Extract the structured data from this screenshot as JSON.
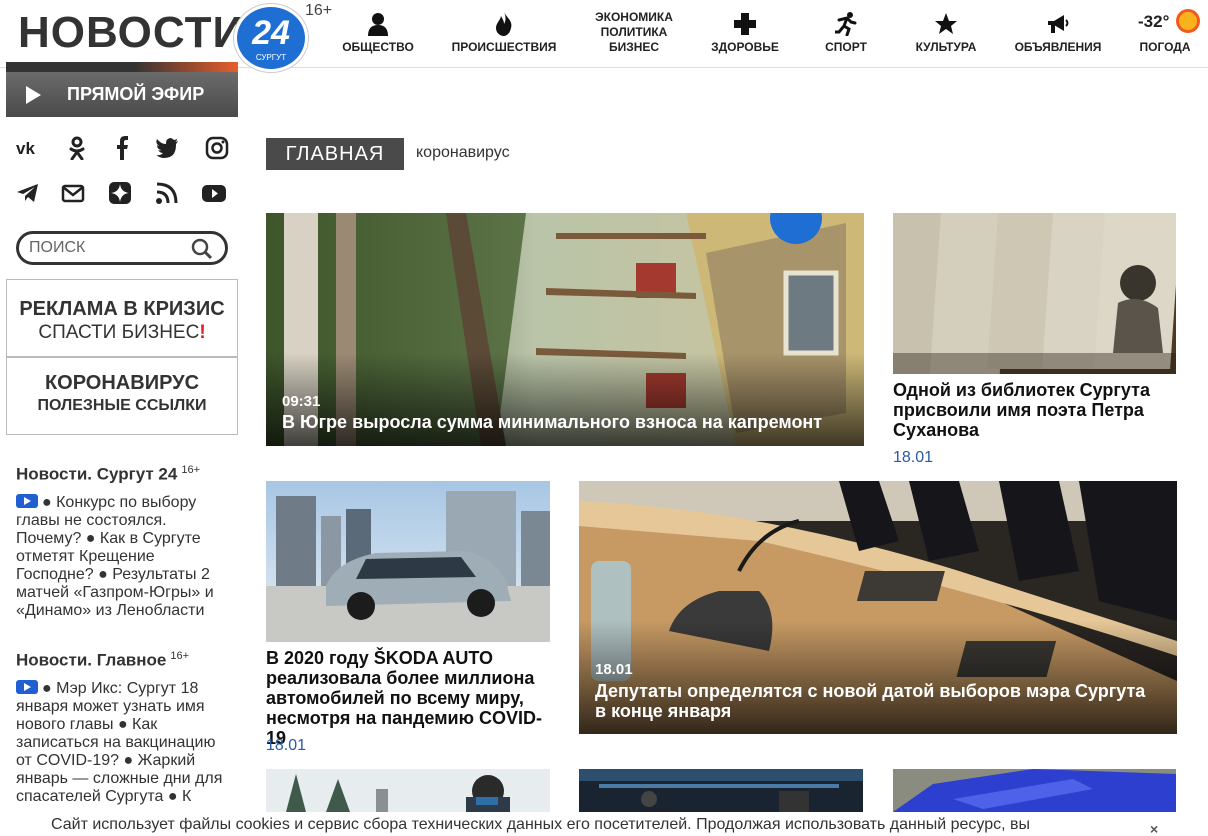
{
  "header": {
    "logo_text": "НОВОСТИ",
    "logo_number": "24",
    "logo_city": "СУРГУТ",
    "age_rating": "16+",
    "nav": [
      {
        "label": "ОБЩЕСТВО",
        "icon": "person-icon"
      },
      {
        "label": "ПРОИСШЕСТВИЯ",
        "icon": "fire-icon"
      },
      {
        "label": "ЗДОРОВЬЕ",
        "icon": "cross-icon"
      },
      {
        "label": "СПОРТ",
        "icon": "runner-icon"
      },
      {
        "label": "КУЛЬТУРА",
        "icon": "star-icon"
      },
      {
        "label": "ОБЪЯВЛЕНИЯ",
        "icon": "megaphone-icon"
      }
    ],
    "nav_multi": [
      "ЭКОНОМИКА",
      "ПОЛИТИКА",
      "БИЗНЕС"
    ],
    "weather": {
      "temp": "-32°",
      "label": "ПОГОДА"
    }
  },
  "live": {
    "label": "ПРЯМОЙ ЭФИР"
  },
  "social": [
    "vk-icon",
    "odnoklassniki-icon",
    "facebook-icon",
    "twitter-icon",
    "instagram-icon",
    "telegram-icon",
    "mail-icon",
    "yandex-zen-icon",
    "rss-icon",
    "youtube-icon"
  ],
  "search": {
    "placeholder": "ПОИСК"
  },
  "promo1": {
    "line1": "РЕКЛАМА В КРИЗИС",
    "line2": "СПАСТИ БИЗНЕС",
    "mark": "!"
  },
  "promo2": {
    "line1": "КОРОНАВИРУС",
    "line2": "ПОЛЕЗНЫЕ ССЫЛКИ"
  },
  "feed1": {
    "title": "Новости. Сургут 24",
    "age": "16+",
    "text": "● Конкурс по выбору главы не состоялся. Почему? ● Как в Сургуте отметят Крещение Господне? ● Результаты 2 матчей «Газпром-Югры» и «Динамо» из Ленобласти"
  },
  "feed2": {
    "title": "Новости. Главное",
    "age": "16+",
    "text": "● Мэр Икс: Сургут 18 января может узнать имя нового главы ● Как записаться на вакцинацию от COVID-19? ● Жаркий январь — сложные дни для спасателей Сургута ● К"
  },
  "breadcrumb": {
    "main": "ГЛАВНАЯ",
    "tag": "коронавирус"
  },
  "articles": {
    "a1": {
      "time": "09:31",
      "title": "В Югре выросла сумма минимального взноса на капремонт"
    },
    "a2": {
      "title": "Одной из библиотек Сургута присвоили имя поэта Петра Суханова",
      "date": "18.01"
    },
    "a3": {
      "title": "В 2020 году ŠKODA AUTO реализовала более миллиона автомобилей по всему миру, несмотря на пандемию COVID-19",
      "date": "18.01"
    },
    "a4": {
      "time": "18.01",
      "title": "Депутаты определятся с новой датой выборов мэра Сургута в конце января"
    }
  },
  "cookie": {
    "text": "Сайт использует файлы cookies и сервис сбора технических данных его посетителей. Продолжая использовать данный ресурс, вы",
    "close": "×"
  }
}
